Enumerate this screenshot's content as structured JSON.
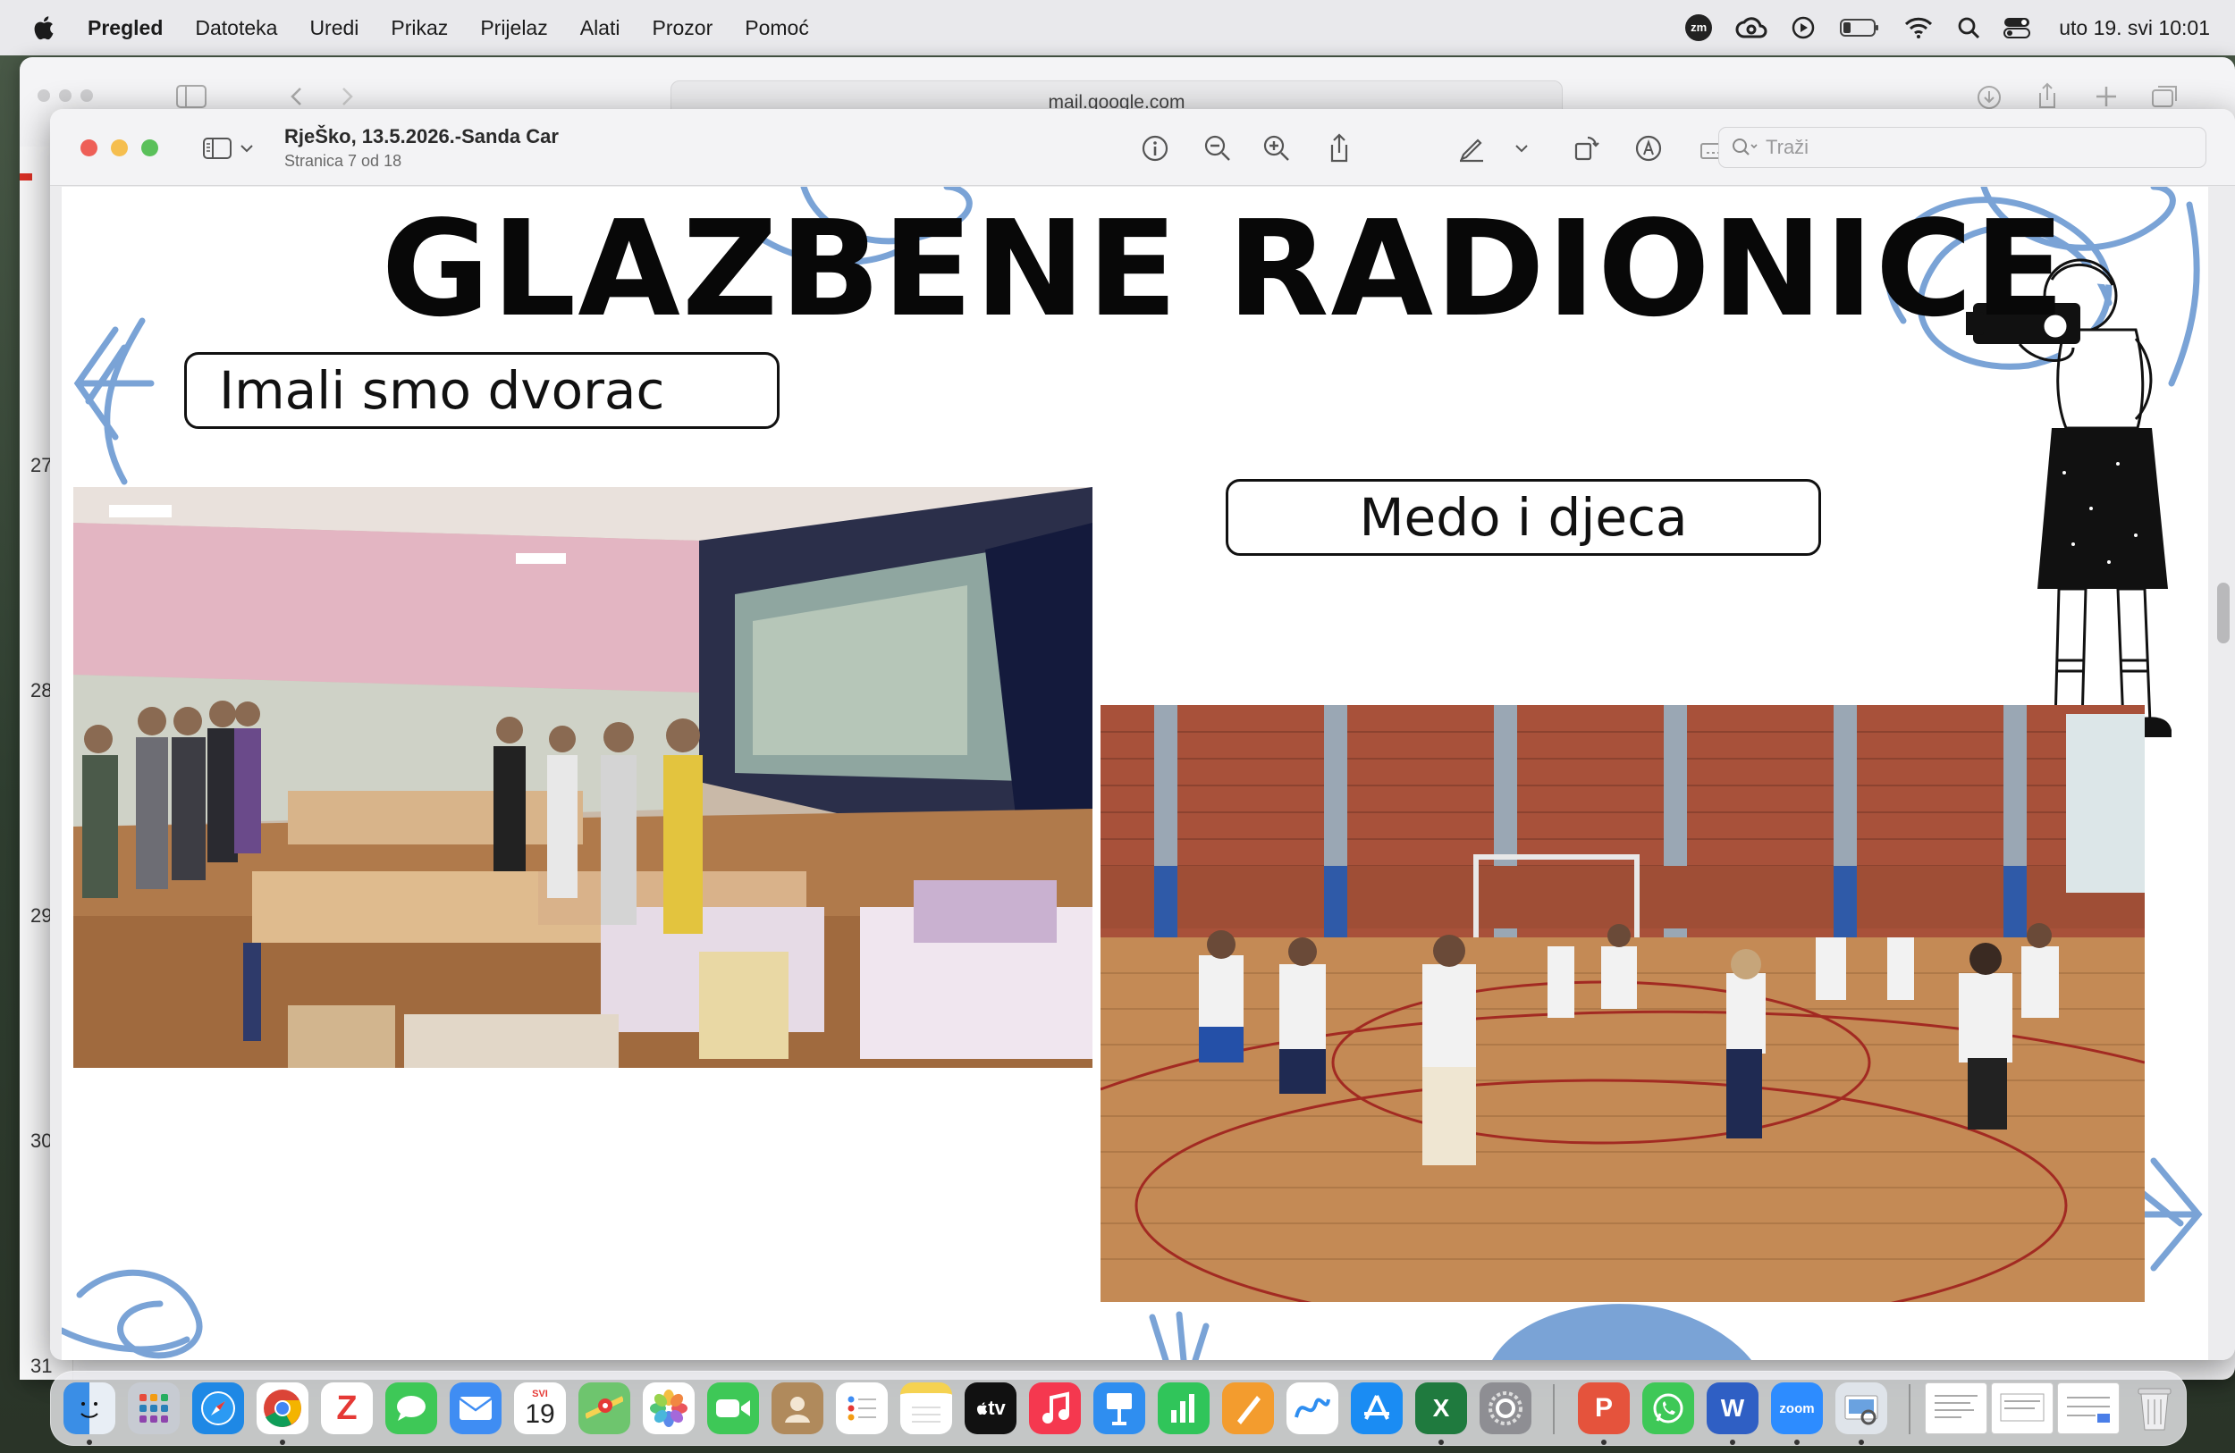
{
  "menubar": {
    "app_name": "Pregled",
    "items": [
      "Datoteka",
      "Uredi",
      "Prikaz",
      "Prijelaz",
      "Alati",
      "Prozor",
      "Pomoć"
    ],
    "zoom_label": "zm",
    "clock": "uto 19. svi  10:01"
  },
  "browser": {
    "url": "mail.google.com",
    "side_numbers": [
      "27",
      "28",
      "29",
      "30",
      "31"
    ]
  },
  "preview": {
    "title": "RjeŠko, 13.5.2026.-Sanda Car",
    "subtitle": "Stranica 7 od 18",
    "search_placeholder": "Traži"
  },
  "slide": {
    "title": "GLAZBENE RADIONICE",
    "label_left": "Imali smo dvorac",
    "label_right": "Medo i djeca",
    "accent_color": "#7aa3d6"
  },
  "dock": {
    "calendar_month": "SVI",
    "calendar_day": "19",
    "tv_label": "tv",
    "zoom_label": "zoom"
  }
}
